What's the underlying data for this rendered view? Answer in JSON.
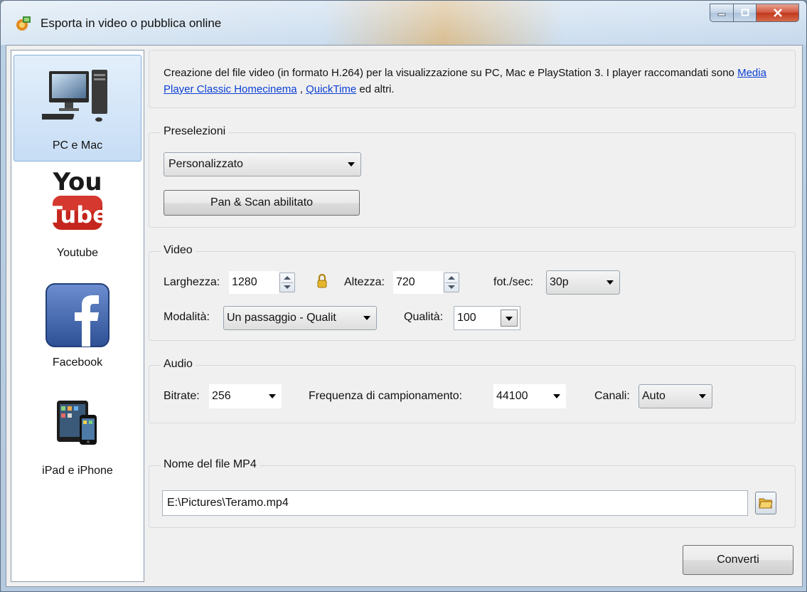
{
  "window": {
    "title": "Esporta in video o pubblica online"
  },
  "sidebar": {
    "items": [
      {
        "label": "PC e Mac",
        "icon": "desktop-computer-icon",
        "selected": true
      },
      {
        "label": "Youtube",
        "icon": "youtube-logo-icon",
        "selected": false
      },
      {
        "label": "Facebook",
        "icon": "facebook-logo-icon",
        "selected": false
      },
      {
        "label": "iPad e iPhone",
        "icon": "ipad-iphone-icon",
        "selected": false
      }
    ]
  },
  "description": {
    "text_before": "Creazione del file video (in formato H.264) per la visualizzazione su PC, Mac e PlayStation 3. I player raccomandati sono ",
    "link1": "Media Player Classic Homecinema",
    "separator": " , ",
    "link2": "QuickTime",
    "text_after": " ed altri."
  },
  "presets": {
    "legend": "Preselezioni",
    "selected": "Personalizzato",
    "pan_scan_button": "Pan & Scan abilitato"
  },
  "video": {
    "legend": "Video",
    "width_label": "Larghezza:",
    "width_value": "1280",
    "height_label": "Altezza:",
    "height_value": "720",
    "fps_label": "fot./sec:",
    "fps_value": "30p",
    "mode_label": "Modalità:",
    "mode_value": "Un passaggio - Qualit",
    "quality_label": "Qualità:",
    "quality_value": "100"
  },
  "audio": {
    "legend": "Audio",
    "bitrate_label": "Bitrate:",
    "bitrate_value": "256",
    "samplerate_label": "Frequenza di campionamento:",
    "samplerate_value": "44100",
    "channels_label": "Canali:",
    "channels_value": "Auto"
  },
  "output": {
    "legend": "Nome del file MP4",
    "filename": "E:\\Pictures\\Teramo.mp4"
  },
  "convert_button": "Converti",
  "colors": {
    "link": "#0a3fd4",
    "selection": "#c7ddf5",
    "close_button": "#c2371c"
  }
}
